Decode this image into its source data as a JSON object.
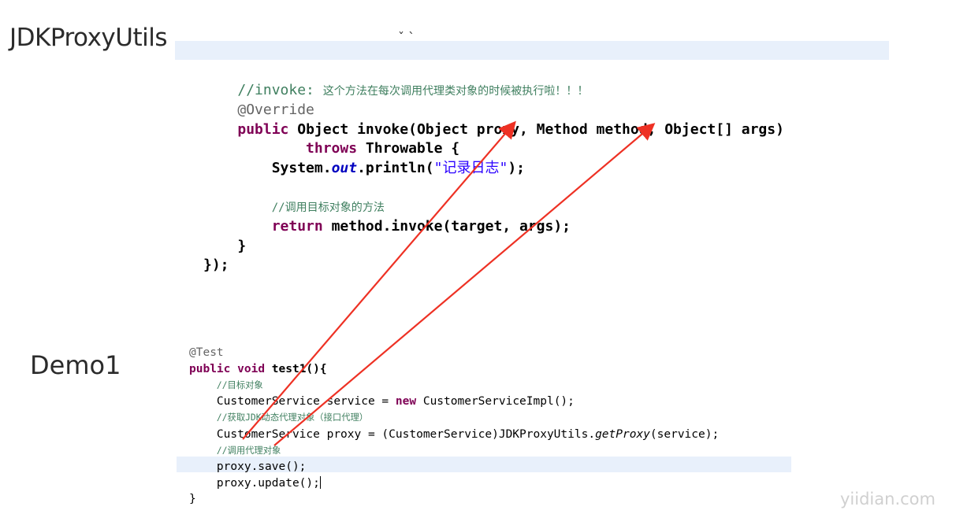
{
  "labels": {
    "title_top": "JDKProxyUtils",
    "title_bottom": "Demo1",
    "stray_text": "ˇ ˋ"
  },
  "watermark": "yiidian.com",
  "colors": {
    "arrow": "#ee3124",
    "highlight": "#e8f0fb",
    "keyword": "#7f0055",
    "comment": "#3f7f5f",
    "string": "#2a00ff"
  },
  "snippet1": {
    "comment_invoke": "//invoke: ",
    "comment_invoke_cn": "这个方法在每次调用代理类对象的时候被执行啦！！！",
    "annotation": "@Override",
    "kw_public": "public",
    "signature": " Object invoke(Object proxy, Method method, Object[] args)",
    "kw_throws": "throws",
    "throws_rest": " Throwable {",
    "sysout_prefix": "System.",
    "sysout_field": "out",
    "sysout_mid": ".println(",
    "sysout_string": "\"记录日志\"",
    "sysout_end": ");",
    "comment_call": "//调用目标对象的方法",
    "kw_return": "return",
    "return_rest": " method.invoke(target, args);",
    "close_brace": "}",
    "close_all": "});"
  },
  "snippet2": {
    "annotation": "@Test",
    "kw_public": "public",
    "kw_void": "void",
    "method_decl": " test1(){",
    "comment_target": "//目标对象",
    "service_decl_a": "CustomerService service = ",
    "kw_new": "new",
    "service_decl_b": " CustomerServiceImpl();",
    "comment_get_proxy": "//获取JDK动态代理对象（接口代理）",
    "proxy_decl_a": "CustomerService proxy = (CustomerService)JDKProxyUtils.",
    "proxy_decl_method": "getProxy",
    "proxy_decl_b": "(service);",
    "comment_call_proxy": "//调用代理对象",
    "call_save": "proxy.save();",
    "call_update": "proxy.update();",
    "close_brace": "}"
  }
}
